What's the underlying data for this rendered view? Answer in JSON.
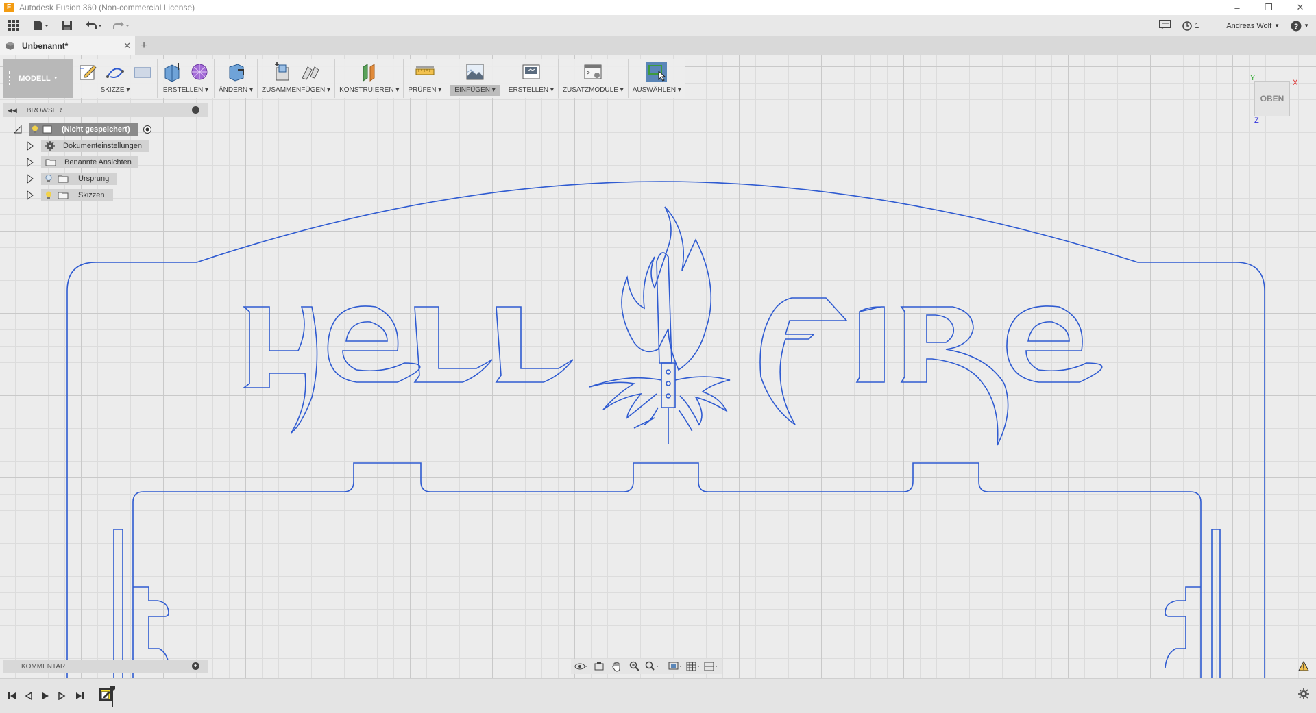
{
  "window": {
    "title": "Autodesk Fusion 360 (Non-commercial License)",
    "app_icon": "F"
  },
  "qat": {
    "user_name": "Andreas Wolf",
    "job_count": "1"
  },
  "tab": {
    "label": "Unbenannt*"
  },
  "ribbon": {
    "workspace": "MODELL",
    "groups": {
      "sketch": "SKIZZE",
      "create": "ERSTELLEN",
      "modify": "ÄNDERN",
      "assemble": "ZUSAMMENFÜGEN",
      "construct": "KONSTRUIEREN",
      "inspect": "PRÜFEN",
      "insert": "EINFÜGEN",
      "make": "ERSTELLEN",
      "addins": "ZUSATZMODULE",
      "select": "AUSWÄHLEN"
    }
  },
  "browser": {
    "title": "BROWSER",
    "root": "(Nicht gespeichert)",
    "items": [
      {
        "label": "Dokumenteinstellungen",
        "icon": "gear-icon"
      },
      {
        "label": "Benannte Ansichten",
        "icon": "folder-icon"
      },
      {
        "label": "Ursprung",
        "icon": "folder-icon"
      },
      {
        "label": "Skizzen",
        "icon": "folder-icon"
      }
    ]
  },
  "comments": {
    "title": "KOMMENTARE"
  },
  "viewcube": {
    "face": "OBEN",
    "axis_x": "X",
    "axis_y": "Y",
    "axis_z": "Z"
  },
  "sketch_text": {
    "left": "HELL",
    "right": "FIRE"
  },
  "colors": {
    "sketch_line": "#2f5bd1",
    "ribbon_active": "#bcbcbc",
    "timeline_feature": "#f7e02a",
    "select_icon": "#2a6db0"
  }
}
